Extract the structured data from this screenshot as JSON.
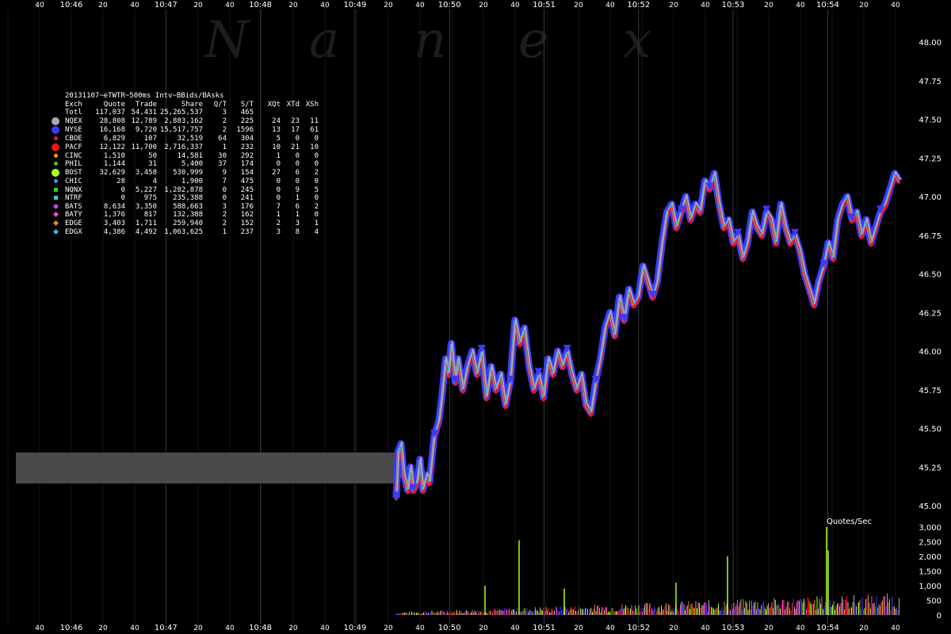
{
  "chart_data": {
    "type": "line",
    "title": "",
    "watermark": [
      "N",
      "a",
      "n",
      "e",
      "x"
    ],
    "x_axis": {
      "time_labels": [
        "10:46",
        "10:47",
        "10:48",
        "10:49",
        "10:50",
        "10:51",
        "10:52",
        "10:53",
        "10:54"
      ],
      "second_labels": [
        "40",
        "20",
        "40",
        "20",
        "40",
        "20",
        "40",
        "20",
        "40",
        "20",
        "40",
        "20",
        "40",
        "20",
        "40",
        "20",
        "40",
        "20",
        "40"
      ]
    },
    "y_axis": {
      "price_ticks": [
        "48.00",
        "47.75",
        "47.50",
        "47.25",
        "47.00",
        "46.75",
        "46.50",
        "46.25",
        "46.00",
        "45.75",
        "45.50",
        "45.25",
        "45.00"
      ],
      "ylim": [
        45.0,
        48.0
      ]
    },
    "sub_chart": {
      "label": "Quotes/Sec",
      "ticks": [
        "3,000",
        "2,500",
        "2,000",
        "1,500",
        "1,000",
        "500",
        "0"
      ],
      "ylim": [
        0,
        3000
      ]
    },
    "price_series": {
      "seconds": [
        0,
        2,
        5,
        8,
        12,
        15,
        18,
        22,
        25,
        28,
        32,
        35,
        40,
        45,
        48,
        52,
        55,
        58,
        62,
        65,
        70,
        75,
        80,
        85,
        90,
        95,
        100,
        105,
        110,
        115,
        120,
        125,
        130,
        135,
        140,
        145,
        150,
        155,
        160,
        165,
        170,
        175,
        180,
        185,
        190,
        195,
        200,
        205,
        210,
        215,
        220,
        225,
        230,
        235,
        240,
        245,
        250,
        255,
        260,
        265,
        270,
        275,
        280,
        285,
        290,
        295,
        300,
        305,
        310,
        315,
        320,
        325,
        330,
        335,
        340,
        345,
        350,
        355,
        360,
        365,
        370,
        375,
        380,
        385,
        390,
        395,
        400,
        405,
        410,
        415,
        420,
        425,
        430,
        435,
        440,
        445,
        450,
        455,
        460,
        465,
        470,
        475,
        480,
        485,
        490,
        495,
        500,
        505,
        510,
        515,
        520,
        525,
        530
      ],
      "values": [
        45.05,
        45.35,
        45.4,
        45.2,
        45.1,
        45.25,
        45.1,
        45.15,
        45.3,
        45.1,
        45.2,
        45.15,
        45.45,
        45.55,
        45.7,
        45.95,
        45.85,
        46.05,
        45.8,
        45.95,
        45.75,
        45.9,
        46.0,
        45.85,
        46.0,
        45.7,
        45.9,
        45.75,
        45.85,
        45.65,
        45.8,
        46.2,
        46.05,
        46.15,
        45.9,
        45.75,
        45.85,
        45.7,
        45.95,
        45.85,
        46.0,
        45.9,
        46.0,
        45.85,
        45.75,
        45.85,
        45.65,
        45.6,
        45.8,
        45.95,
        46.15,
        46.25,
        46.1,
        46.35,
        46.2,
        46.4,
        46.3,
        46.35,
        46.55,
        46.45,
        46.35,
        46.45,
        46.7,
        46.9,
        46.95,
        46.8,
        46.9,
        47.0,
        46.85,
        46.95,
        46.9,
        47.1,
        47.05,
        47.15,
        46.95,
        46.8,
        46.85,
        46.7,
        46.75,
        46.6,
        46.7,
        46.9,
        46.8,
        46.75,
        46.9,
        46.85,
        46.7,
        46.95,
        46.8,
        46.7,
        46.75,
        46.65,
        46.5,
        46.4,
        46.3,
        46.45,
        46.55,
        46.7,
        46.6,
        46.85,
        46.95,
        47.0,
        46.85,
        46.9,
        46.75,
        46.85,
        46.7,
        46.8,
        46.9,
        46.95,
        47.05,
        47.15,
        47.1
      ]
    },
    "legend": {
      "title": "20131107~eTWTR~500ms Intv~BBids/BAsks",
      "columns": [
        "Exch",
        "Quote",
        "Trade",
        "Share",
        "Q/T",
        "S/T",
        "XQt",
        "XTd",
        "XSh"
      ],
      "rows": [
        {
          "exch": "Totl",
          "quote": "117,037",
          "trade": "54,431",
          "share": "25,265,537",
          "qt": "3",
          "st": "465",
          "xqt": "",
          "xtd": "",
          "xsh": "",
          "color": "",
          "shape": "none"
        },
        {
          "exch": "NQEX",
          "quote": "28,808",
          "trade": "12,789",
          "share": "2,883,162",
          "qt": "2",
          "st": "225",
          "xqt": "24",
          "xtd": "23",
          "xsh": "11",
          "color": "#aaaaaa",
          "shape": "big"
        },
        {
          "exch": "NYSE",
          "quote": "16,168",
          "trade": "9,720",
          "share": "15,517,757",
          "qt": "2",
          "st": "1596",
          "xqt": "13",
          "xtd": "17",
          "xsh": "61",
          "color": "#3a3aff",
          "shape": "big"
        },
        {
          "exch": "CBOE",
          "quote": "6,829",
          "trade": "107",
          "share": "32,519",
          "qt": "64",
          "st": "304",
          "xqt": "5",
          "xtd": "0",
          "xsh": "0",
          "color": "#e0204a",
          "shape": "small"
        },
        {
          "exch": "PACF",
          "quote": "12,122",
          "trade": "11,700",
          "share": "2,716,337",
          "qt": "1",
          "st": "232",
          "xqt": "10",
          "xtd": "21",
          "xsh": "10",
          "color": "#ff1010",
          "shape": "big"
        },
        {
          "exch": "CINC",
          "quote": "1,510",
          "trade": "50",
          "share": "14,581",
          "qt": "30",
          "st": "292",
          "xqt": "1",
          "xtd": "0",
          "xsh": "0",
          "color": "#ffaa00",
          "shape": "small"
        },
        {
          "exch": "PHIL",
          "quote": "1,144",
          "trade": "31",
          "share": "5,400",
          "qt": "37",
          "st": "174",
          "xqt": "0",
          "xtd": "0",
          "xsh": "0",
          "color": "#33cc33",
          "shape": "small"
        },
        {
          "exch": "BOST",
          "quote": "32,629",
          "trade": "3,458",
          "share": "530,999",
          "qt": "9",
          "st": "154",
          "xqt": "27",
          "xtd": "6",
          "xsh": "2",
          "color": "#aaff22",
          "shape": "big"
        },
        {
          "exch": "CHIC",
          "quote": "28",
          "trade": "4",
          "share": "1,900",
          "qt": "7",
          "st": "475",
          "xqt": "0",
          "xtd": "0",
          "xsh": "0",
          "color": "#3399ff",
          "shape": "small"
        },
        {
          "exch": "NQNX",
          "quote": "0",
          "trade": "5,227",
          "share": "1,282,878",
          "qt": "0",
          "st": "245",
          "xqt": "0",
          "xtd": "9",
          "xsh": "5",
          "color": "#22dd22",
          "shape": "square"
        },
        {
          "exch": "NTRF",
          "quote": "0",
          "trade": "975",
          "share": "235,388",
          "qt": "0",
          "st": "241",
          "xqt": "0",
          "xtd": "1",
          "xsh": "0",
          "color": "#33cccc",
          "shape": "square"
        },
        {
          "exch": "BATS",
          "quote": "8,634",
          "trade": "3,350",
          "share": "588,663",
          "qt": "3",
          "st": "176",
          "xqt": "7",
          "xtd": "6",
          "xsh": "2",
          "color": "#aa55ff",
          "shape": "diamond"
        },
        {
          "exch": "BATY",
          "quote": "1,376",
          "trade": "817",
          "share": "132,388",
          "qt": "2",
          "st": "162",
          "xqt": "1",
          "xtd": "1",
          "xsh": "0",
          "color": "#ff44cc",
          "shape": "diamond"
        },
        {
          "exch": "EDGE",
          "quote": "3,403",
          "trade": "1,711",
          "share": "259,940",
          "qt": "2",
          "st": "152",
          "xqt": "2",
          "xtd": "3",
          "xsh": "1",
          "color": "#dd8833",
          "shape": "diamond"
        },
        {
          "exch": "EDGX",
          "quote": "4,386",
          "trade": "4,492",
          "share": "1,063,625",
          "qt": "1",
          "st": "237",
          "xqt": "3",
          "xtd": "8",
          "xsh": "4",
          "color": "#44aadd",
          "shape": "diamond"
        }
      ]
    },
    "grid": true
  }
}
